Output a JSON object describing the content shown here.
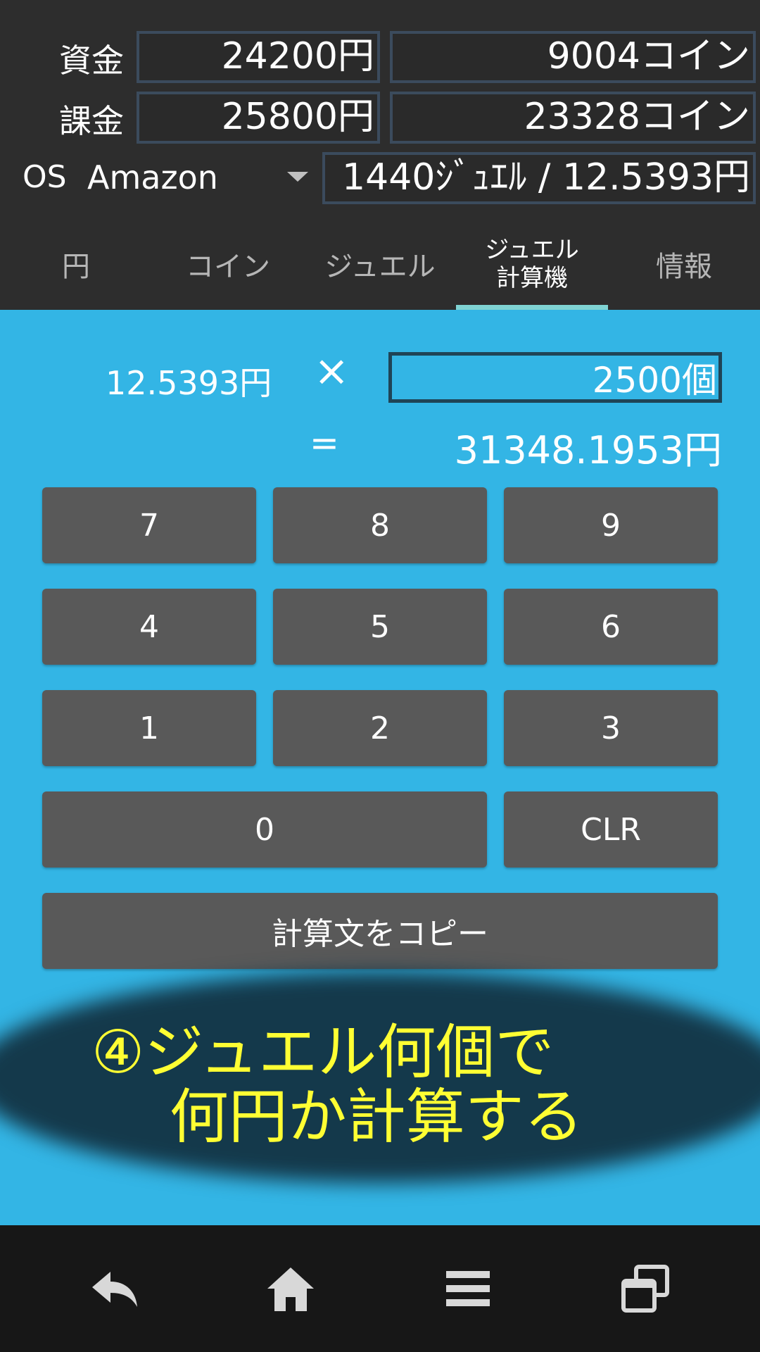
{
  "header": {
    "funds_label": "資金",
    "funds_yen": "24200円",
    "funds_coin": "9004コイン",
    "charge_label": "課金",
    "charge_yen": "25800円",
    "charge_coin": "23328コイン",
    "os_label": "OS",
    "os_value": "Amazon",
    "jewel_rate": "1440ｼﾞｭｴﾙ / 12.5393円"
  },
  "tabs": [
    {
      "label": "円"
    },
    {
      "label": "コイン"
    },
    {
      "label": "ジュエル"
    },
    {
      "label": "ジュエル\n計算機",
      "active": true
    },
    {
      "label": "情報"
    }
  ],
  "calculator": {
    "unit_price": "12.5393円",
    "times": "×",
    "quantity": "2500個",
    "equals": "=",
    "result": "31348.1953円",
    "keys": [
      "7",
      "8",
      "9",
      "4",
      "5",
      "6",
      "1",
      "2",
      "3",
      "0",
      "CLR"
    ],
    "copy_label": "計算文をコピー"
  },
  "annotation": {
    "text": "④ジュエル何個で\n　 何円か計算する"
  },
  "navbar": {
    "icons": [
      "back-icon",
      "home-icon",
      "menu-icon",
      "recent-apps-icon"
    ]
  },
  "colors": {
    "accent": "#33b5e5",
    "header_bg": "#2d2d2d",
    "key_bg": "#595959",
    "tab_indicator": "#7fd3d3",
    "annotation_text": "#ffff33",
    "navbar_bg": "#171717"
  }
}
